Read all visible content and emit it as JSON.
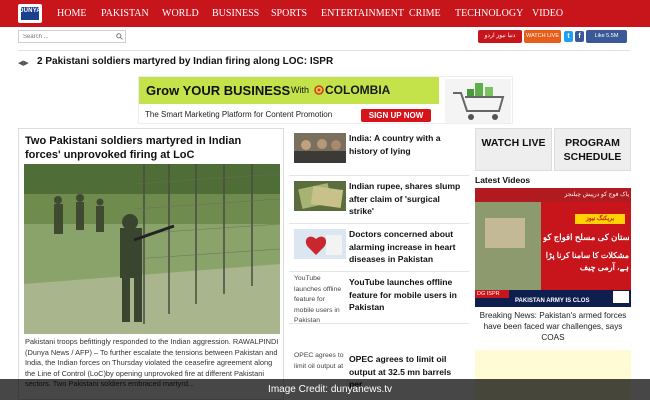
{
  "header": {
    "logo_text": "DUNYA",
    "nav": [
      "HOME",
      "PAKISTAN",
      "WORLD",
      "BUSINESS",
      "SPORTS",
      "ENTERTAINMENT",
      "CRIME",
      "TECHNOLOGY",
      "VIDEO"
    ]
  },
  "search": {
    "placeholder": "Search ..."
  },
  "topbar": {
    "urdu_button": "دنیا نیوز اردو",
    "live_button": "WATCH LIVE",
    "likes": "Like 5.5M"
  },
  "ticker": {
    "text": "2 Pakistani soldiers martyred by Indian firing along LOC: ISPR"
  },
  "ad": {
    "headline": "Grow YOUR BUSINESS",
    "with": "With",
    "brand": "COLOMBIA",
    "tagline": "The Smart Marketing Platform for Content Promotion",
    "cta": "SIGN UP NOW"
  },
  "main_story": {
    "title": "Two Pakistani soldiers martyred in Indian forces' unprovoked firing at LoC",
    "caption": "Pakistani troops befittingly responded to the Indian aggression. RAWALPINDI (Dunya News / AFP) – To further escalate the tensions between Pakistan and India, the Indian forces on Thursday violated the ceasefire agreement along the Line of Control (LoC)by opening unprovoked fire at different Pakistani sectors. Two Pakistani soldiers embraced martyrd..."
  },
  "stories": [
    {
      "title": "India: A country with a history of lying"
    },
    {
      "title": "Indian rupee, shares slump after claim of 'surgical strike'"
    },
    {
      "title": "Doctors concerned about alarming increase in heart diseases in Pakistan"
    },
    {
      "thumb_text": "YouTube launches offline feature for mobile users in Pakistan",
      "title": "YouTube launches offline feature for mobile users in Pakistan"
    },
    {
      "thumb_text": "OPEC agrees to limit oil output at",
      "title": "OPEC agrees to limit oil output at 32.5 mn barrels per"
    }
  ],
  "sidebar": {
    "watch_live": "WATCH LIVE",
    "program_schedule": "PROGRAM SCHEDULE",
    "latest_videos": "Latest Videos",
    "video_caption": "Breaking News: Pakistan's armed forces have been faced war challenges, says COAS",
    "video_overlay_line1": "پاک فوج کو درپیش چیلنجز",
    "video_overlay_line2": "پاکستان کی مسلح افواج کو",
    "video_overlay_line3": "مشکلات کا سامنا کرنا پڑا ہے، آرمی چیف",
    "breaking_tag": "بریکنگ نیوز",
    "ispr_tag": "DG ISPR",
    "army_tag": "PAKISTAN ARMY IS CLOS"
  },
  "credit": {
    "text": "Image Credit: dunyanews.tv"
  },
  "colors": {
    "brand_red": "#c8141b",
    "facebook": "#3b5998",
    "live_orange": "#e85d1a"
  }
}
